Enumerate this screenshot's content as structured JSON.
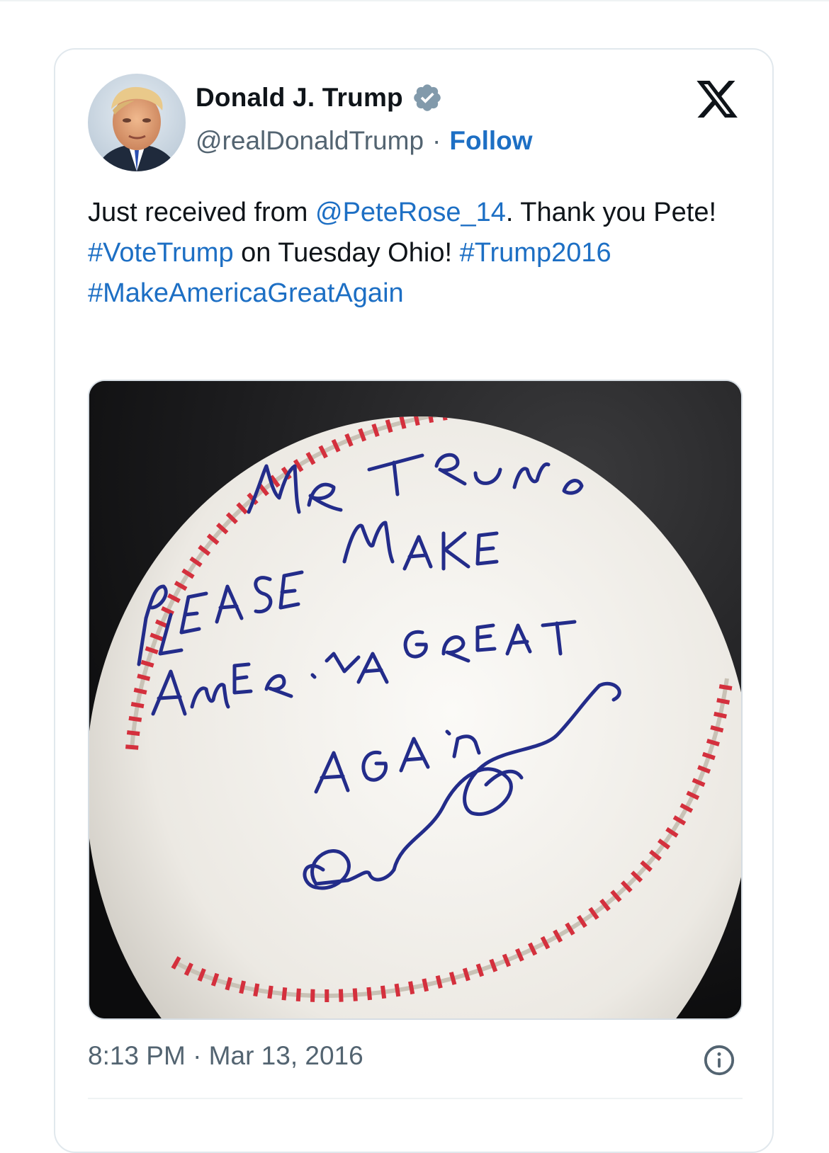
{
  "author": {
    "display_name": "Donald J. Trump",
    "handle": "@realDonaldTrump",
    "separator": "·",
    "follow_label": "Follow",
    "verified": true
  },
  "tweet": {
    "parts": [
      {
        "text": "Just received from ",
        "type": "text"
      },
      {
        "text": "@PeteRose_14",
        "type": "mention"
      },
      {
        "text": ". Thank you Pete! ",
        "type": "text"
      },
      {
        "text": "#VoteTrump",
        "type": "hashtag"
      },
      {
        "text": " on Tuesday Ohio! ",
        "type": "text"
      },
      {
        "text": "#Trump2016",
        "type": "hashtag"
      },
      {
        "text": " ",
        "type": "text"
      },
      {
        "text": "#MakeAmericaGreatAgain",
        "type": "hashtag"
      }
    ],
    "timestamp": "8:13 PM · Mar 13, 2016"
  },
  "media": {
    "subject": "autographed baseball",
    "inscription": [
      "Mr. Trump",
      "Please Make",
      "America Great",
      "Again",
      "Pete Rose"
    ]
  },
  "icons": {
    "platform_logo": "x-logo-icon",
    "verified": "verified-badge-icon",
    "info": "info-icon"
  },
  "colors": {
    "link": "#1d6fc4",
    "secondary_text": "#536471",
    "primary_text": "#0f1419",
    "verified_badge": "#829aab",
    "card_border": "#e1e8ed"
  }
}
